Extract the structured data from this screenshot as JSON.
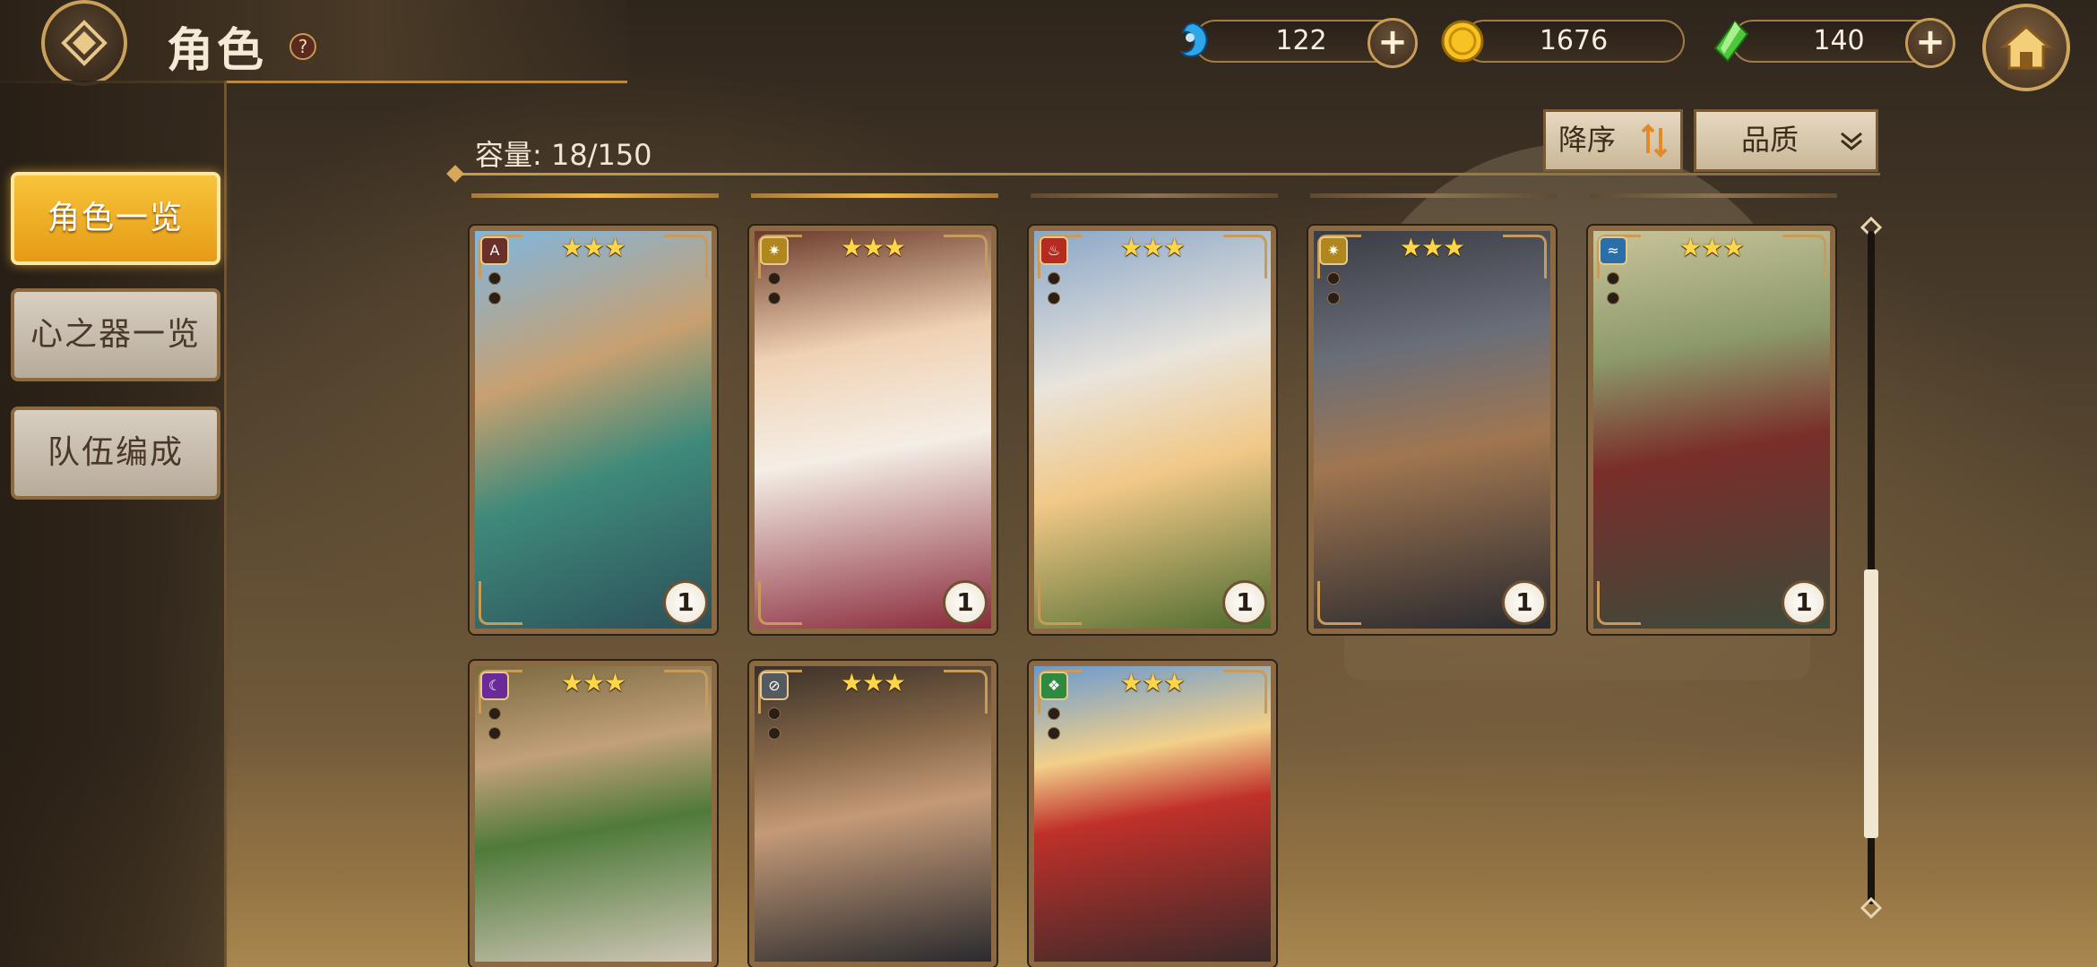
{
  "header": {
    "title": "角色",
    "help": "?"
  },
  "currencies": [
    {
      "name": "blue-gem",
      "value": "122"
    },
    {
      "name": "gold-coin",
      "value": "1676"
    },
    {
      "name": "green-crystal",
      "value": "140"
    }
  ],
  "nav": {
    "items": [
      {
        "label": "角色一览",
        "active": true
      },
      {
        "label": "心之器一览",
        "active": false
      },
      {
        "label": "队伍编成",
        "active": false
      }
    ]
  },
  "toolbar": {
    "capacity": "容量: 18/150",
    "sort_label": "降序",
    "filter_label": "品质"
  },
  "cards": [
    {
      "element": "wind-type-icon",
      "stars": "★★★",
      "count": "1"
    },
    {
      "element": "holy-type-icon",
      "stars": "★★★",
      "count": "1"
    },
    {
      "element": "fire-type-icon",
      "stars": "★★★",
      "count": "1"
    },
    {
      "element": "holy-type-icon",
      "stars": "★★★",
      "count": "1"
    },
    {
      "element": "water-type-icon",
      "stars": "★★★",
      "count": "1"
    },
    {
      "element": "dark-type-icon",
      "stars": "★★★",
      "count": ""
    },
    {
      "element": "neutral-type-icon",
      "stars": "★★★",
      "count": ""
    },
    {
      "element": "earth-type-icon",
      "stars": "★★★",
      "count": ""
    }
  ],
  "colors": {
    "accent_gold": "#e69b15",
    "frame_brown": "#8b6a43",
    "text_light": "#f5ead5"
  }
}
